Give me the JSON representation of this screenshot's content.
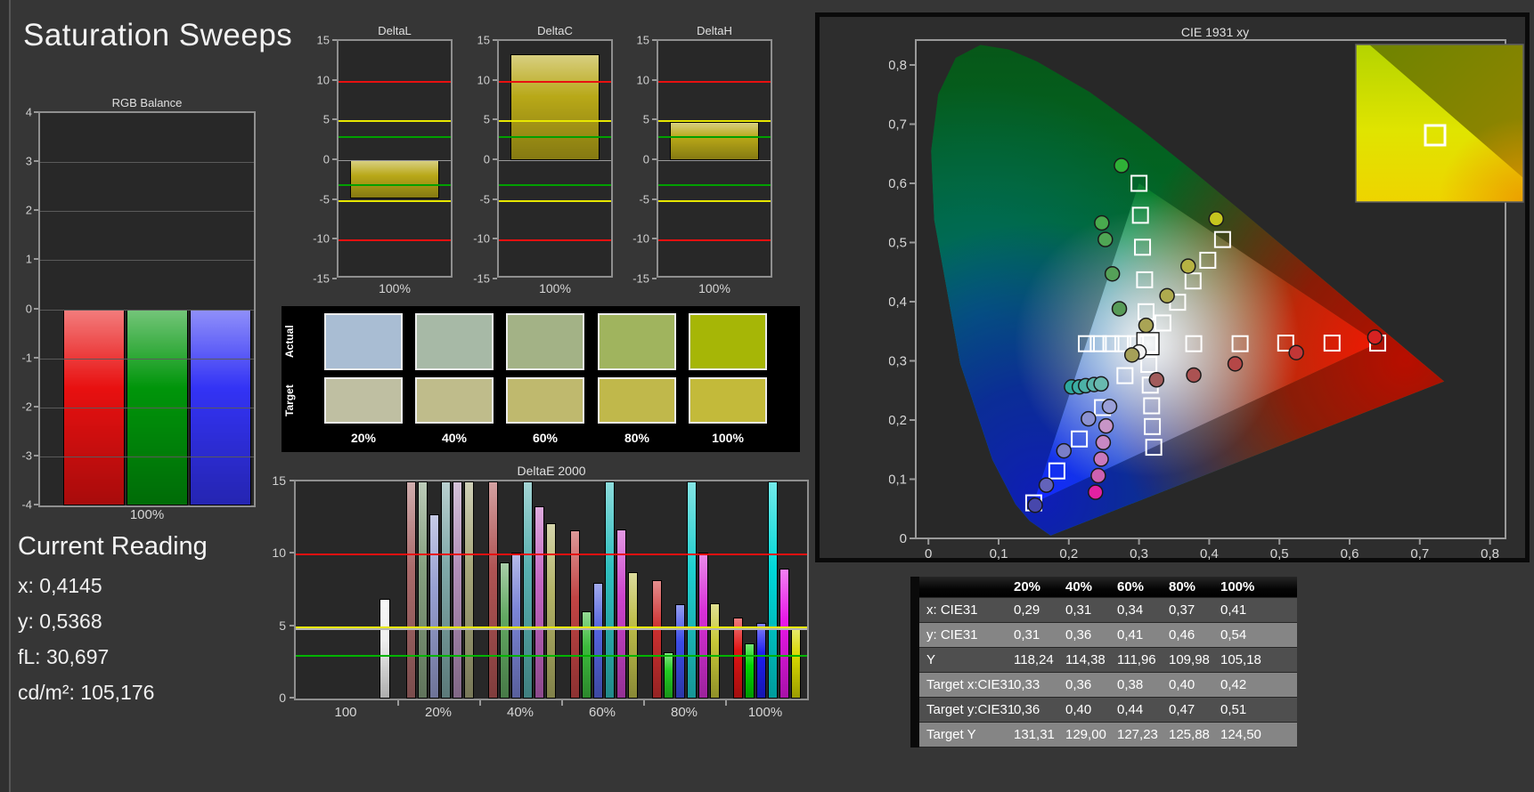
{
  "title": "Saturation Sweeps",
  "current_reading": {
    "heading": "Current Reading",
    "lines": [
      "x: 0,4145",
      "y: 0,5368",
      "fL: 30,697",
      "cd/m²: 105,176"
    ]
  },
  "swatch_panel": {
    "row_labels": [
      "Actual",
      "Target"
    ],
    "col_labels": [
      "20%",
      "40%",
      "60%",
      "80%",
      "100%"
    ],
    "actual_colors": [
      "#a9bdd3",
      "#a7b9a6",
      "#a3b286",
      "#a0b45e",
      "#a6b606"
    ],
    "target_colors": [
      "#bfbfa2",
      "#bfbc8b",
      "#bfb96e",
      "#c0b84b",
      "#c3ba3a"
    ]
  },
  "chart_data": {
    "rgb_balance": {
      "type": "bar",
      "title": "RGB Balance",
      "x_label": "100%",
      "ylim": [
        -4,
        4
      ],
      "y_ticks": [
        4,
        3,
        2,
        1,
        0,
        -1,
        -2,
        -3,
        -4
      ],
      "series": [
        {
          "name": "red",
          "value": -4,
          "clipped": true,
          "color": "#e81010"
        },
        {
          "name": "green",
          "value": -4,
          "clipped": true,
          "color": "#00950a"
        },
        {
          "name": "blue",
          "value": -4,
          "clipped": true,
          "color": "#3333f5"
        }
      ]
    },
    "delta_ref_lines": {
      "red": 10,
      "yellow": 5,
      "green": 3
    },
    "delta_charts": [
      {
        "title": "DeltaL",
        "x_label": "100%",
        "ylim": [
          -15,
          15
        ],
        "y_ticks": [
          15,
          10,
          5,
          0,
          -5,
          -10,
          -15
        ],
        "value": -4.8
      },
      {
        "title": "DeltaC",
        "x_label": "100%",
        "ylim": [
          -15,
          15
        ],
        "y_ticks": [
          15,
          10,
          5,
          0,
          -5,
          -10,
          -15
        ],
        "value": 13.3
      },
      {
        "title": "DeltaH",
        "x_label": "100%",
        "ylim": [
          -15,
          15
        ],
        "y_ticks": [
          15,
          10,
          5,
          0,
          -5,
          -10,
          -15
        ],
        "value": 4.8
      }
    ],
    "deltae2000": {
      "type": "bar",
      "title": "DeltaE 2000",
      "ylim": [
        0,
        15
      ],
      "y_ticks": [
        0,
        5,
        10,
        15
      ],
      "ref_lines": {
        "red": 10,
        "yellow": 5,
        "green": 3,
        "average": 4.85
      },
      "groups": [
        {
          "label": "100",
          "bars": [
            {
              "color": "#f0f0f0",
              "value": 6.9
            }
          ]
        },
        {
          "label": "20%",
          "bars": [
            {
              "color": "#a96a6a",
              "value": 15,
              "clipped": true
            },
            {
              "color": "#85a07f",
              "value": 15,
              "clipped": true
            },
            {
              "color": "#98a0d2",
              "value": 12.7
            },
            {
              "color": "#7fa8a8",
              "value": 15,
              "clipped": true
            },
            {
              "color": "#b28fb9",
              "value": 15,
              "clipped": true
            },
            {
              "color": "#a6a67a",
              "value": 15,
              "clipped": true
            }
          ]
        },
        {
          "label": "40%",
          "bars": [
            {
              "color": "#b05454",
              "value": 15,
              "clipped": true
            },
            {
              "color": "#62a862",
              "value": 9.4
            },
            {
              "color": "#7a84d6",
              "value": 10.1
            },
            {
              "color": "#58b0b0",
              "value": 15,
              "clipped": true
            },
            {
              "color": "#c266c2",
              "value": 13.3
            },
            {
              "color": "#b2b266",
              "value": 12.1
            }
          ]
        },
        {
          "label": "60%",
          "bars": [
            {
              "color": "#c24444",
              "value": 11.6
            },
            {
              "color": "#3dbb3d",
              "value": 6.0
            },
            {
              "color": "#5464de",
              "value": 8.0
            },
            {
              "color": "#2fbfbf",
              "value": 15,
              "clipped": true
            },
            {
              "color": "#cc44cc",
              "value": 11.7
            },
            {
              "color": "#bdbd4a",
              "value": 8.7
            }
          ]
        },
        {
          "label": "80%",
          "bars": [
            {
              "color": "#cc3030",
              "value": 8.2
            },
            {
              "color": "#22cc22",
              "value": 3.2
            },
            {
              "color": "#3c4ce6",
              "value": 6.5
            },
            {
              "color": "#1fcfcf",
              "value": 15,
              "clipped": true
            },
            {
              "color": "#d830d8",
              "value": 10.1
            },
            {
              "color": "#c8c838",
              "value": 6.6
            }
          ]
        },
        {
          "label": "100%",
          "bars": [
            {
              "color": "#e01414",
              "value": 5.6
            },
            {
              "color": "#00d400",
              "value": 3.8
            },
            {
              "color": "#1e1ef0",
              "value": 5.2
            },
            {
              "color": "#00d8d8",
              "value": 15,
              "clipped": true
            },
            {
              "color": "#e818e8",
              "value": 9.0
            },
            {
              "color": "#d8d800",
              "value": 5.0
            }
          ]
        }
      ]
    },
    "cie": {
      "type": "scatter",
      "title": "CIE 1931 xy",
      "x_ticks": [
        "0",
        "0,1",
        "0,2",
        "0,3",
        "0,4",
        "0,5",
        "0,6",
        "0,7",
        "0,8"
      ],
      "y_ticks": [
        "0",
        "0,1",
        "0,2",
        "0,3",
        "0,4",
        "0,5",
        "0,6",
        "0,7",
        "0,8"
      ],
      "x_tick_values": [
        0,
        0.1,
        0.2,
        0.3,
        0.4,
        0.5,
        0.6,
        0.7,
        0.8
      ],
      "y_tick_values": [
        0,
        0.1,
        0.2,
        0.3,
        0.4,
        0.5,
        0.6,
        0.7,
        0.8
      ],
      "gamut_triangle": [
        [
          0.64,
          0.33
        ],
        [
          0.3,
          0.6
        ],
        [
          0.15,
          0.06
        ]
      ],
      "white_point": [
        0.3127,
        0.329
      ],
      "target_squares": [
        [
          0.378,
          0.329
        ],
        [
          0.444,
          0.329
        ],
        [
          0.509,
          0.33
        ],
        [
          0.575,
          0.33
        ],
        [
          0.64,
          0.33
        ],
        [
          0.31,
          0.383
        ],
        [
          0.308,
          0.437
        ],
        [
          0.305,
          0.492
        ],
        [
          0.302,
          0.546
        ],
        [
          0.3,
          0.6
        ],
        [
          0.28,
          0.275
        ],
        [
          0.248,
          0.221
        ],
        [
          0.215,
          0.168
        ],
        [
          0.183,
          0.114
        ],
        [
          0.15,
          0.06
        ],
        [
          0.295,
          0.329
        ],
        [
          0.277,
          0.329
        ],
        [
          0.26,
          0.329
        ],
        [
          0.242,
          0.329
        ],
        [
          0.225,
          0.329
        ],
        [
          0.314,
          0.294
        ],
        [
          0.316,
          0.259
        ],
        [
          0.318,
          0.224
        ],
        [
          0.319,
          0.189
        ],
        [
          0.321,
          0.154
        ],
        [
          0.334,
          0.364
        ],
        [
          0.355,
          0.399
        ],
        [
          0.377,
          0.435
        ],
        [
          0.398,
          0.47
        ],
        [
          0.419,
          0.505
        ]
      ],
      "measured_points": [
        {
          "x": 0.3,
          "y": 0.315,
          "color": "#f2f2f2"
        },
        {
          "x": 0.325,
          "y": 0.268,
          "color": "#a25c5c"
        },
        {
          "x": 0.378,
          "y": 0.276,
          "color": "#ab5252"
        },
        {
          "x": 0.437,
          "y": 0.295,
          "color": "#b54747"
        },
        {
          "x": 0.524,
          "y": 0.314,
          "color": "#c23636"
        },
        {
          "x": 0.636,
          "y": 0.34,
          "color": "#d62222"
        },
        {
          "x": 0.272,
          "y": 0.388,
          "color": "#579b58"
        },
        {
          "x": 0.262,
          "y": 0.447,
          "color": "#55a158"
        },
        {
          "x": 0.252,
          "y": 0.505,
          "color": "#4fa654"
        },
        {
          "x": 0.247,
          "y": 0.533,
          "color": "#49aa4e"
        },
        {
          "x": 0.275,
          "y": 0.63,
          "color": "#2fb037"
        },
        {
          "x": 0.258,
          "y": 0.223,
          "color": "#9aa0d8"
        },
        {
          "x": 0.228,
          "y": 0.202,
          "color": "#8c92d2"
        },
        {
          "x": 0.193,
          "y": 0.148,
          "color": "#7a7ec8"
        },
        {
          "x": 0.168,
          "y": 0.09,
          "color": "#6363ba"
        },
        {
          "x": 0.152,
          "y": 0.056,
          "color": "#4747ac"
        },
        {
          "x": 0.204,
          "y": 0.256,
          "color": "#2ea89e"
        },
        {
          "x": 0.215,
          "y": 0.256,
          "color": "#3cada3"
        },
        {
          "x": 0.224,
          "y": 0.258,
          "color": "#4cb1a7"
        },
        {
          "x": 0.236,
          "y": 0.26,
          "color": "#5ab5ab"
        },
        {
          "x": 0.246,
          "y": 0.261,
          "color": "#68b9af"
        },
        {
          "x": 0.253,
          "y": 0.19,
          "color": "#c795c7"
        },
        {
          "x": 0.249,
          "y": 0.162,
          "color": "#c788c3"
        },
        {
          "x": 0.246,
          "y": 0.134,
          "color": "#c979bd"
        },
        {
          "x": 0.242,
          "y": 0.106,
          "color": "#cd61b1"
        },
        {
          "x": 0.238,
          "y": 0.078,
          "color": "#e221a2"
        },
        {
          "x": 0.29,
          "y": 0.31,
          "color": "#a5a058"
        },
        {
          "x": 0.31,
          "y": 0.36,
          "color": "#a9a455"
        },
        {
          "x": 0.34,
          "y": 0.41,
          "color": "#aeaa4e"
        },
        {
          "x": 0.37,
          "y": 0.46,
          "color": "#b6b243"
        },
        {
          "x": 0.41,
          "y": 0.54,
          "color": "#c5c51e"
        }
      ]
    }
  },
  "table": {
    "col_headers": [
      "20%",
      "40%",
      "60%",
      "80%",
      "100%"
    ],
    "rows": [
      {
        "label": "x: CIE31",
        "values": [
          "0,29",
          "0,31",
          "0,34",
          "0,37",
          "0,41"
        ]
      },
      {
        "label": "y: CIE31",
        "values": [
          "0,31",
          "0,36",
          "0,41",
          "0,46",
          "0,54"
        ]
      },
      {
        "label": "Y",
        "values": [
          "118,24",
          "114,38",
          "111,96",
          "109,98",
          "105,18"
        ]
      },
      {
        "label": "Target x:CIE31",
        "values": [
          "0,33",
          "0,36",
          "0,38",
          "0,40",
          "0,42"
        ]
      },
      {
        "label": "Target y:CIE31",
        "values": [
          "0,36",
          "0,40",
          "0,44",
          "0,47",
          "0,51"
        ]
      },
      {
        "label": "Target Y",
        "values": [
          "131,31",
          "129,00",
          "127,23",
          "125,88",
          "124,50"
        ]
      }
    ]
  }
}
